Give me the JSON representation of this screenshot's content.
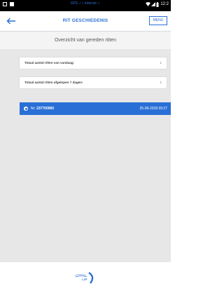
{
  "statusbar": {
    "gps_label": "GPS",
    "separator": "|",
    "internet_label": "Internet",
    "check": "✓",
    "time": "12:2"
  },
  "header": {
    "title": "RIT GESCHIEDENIS",
    "menu_label": "MENU"
  },
  "subheader": {
    "text": "Overzicht van gereden ritten"
  },
  "stats": [
    {
      "label": "Totaal aantal ritten van vandaag:",
      "value": "1"
    },
    {
      "label": "Totaal aantal ritten afgelopen 7 dagen:",
      "value": "1"
    }
  ],
  "ride": {
    "prefix": "Nr:",
    "number": "237700960",
    "date": "25-09-2018 09:27"
  },
  "footer": {
    "logo_text": "LZP"
  },
  "colors": {
    "accent": "#2a6fd6",
    "background": "#e7e7e7",
    "statusbar": "#000000"
  }
}
